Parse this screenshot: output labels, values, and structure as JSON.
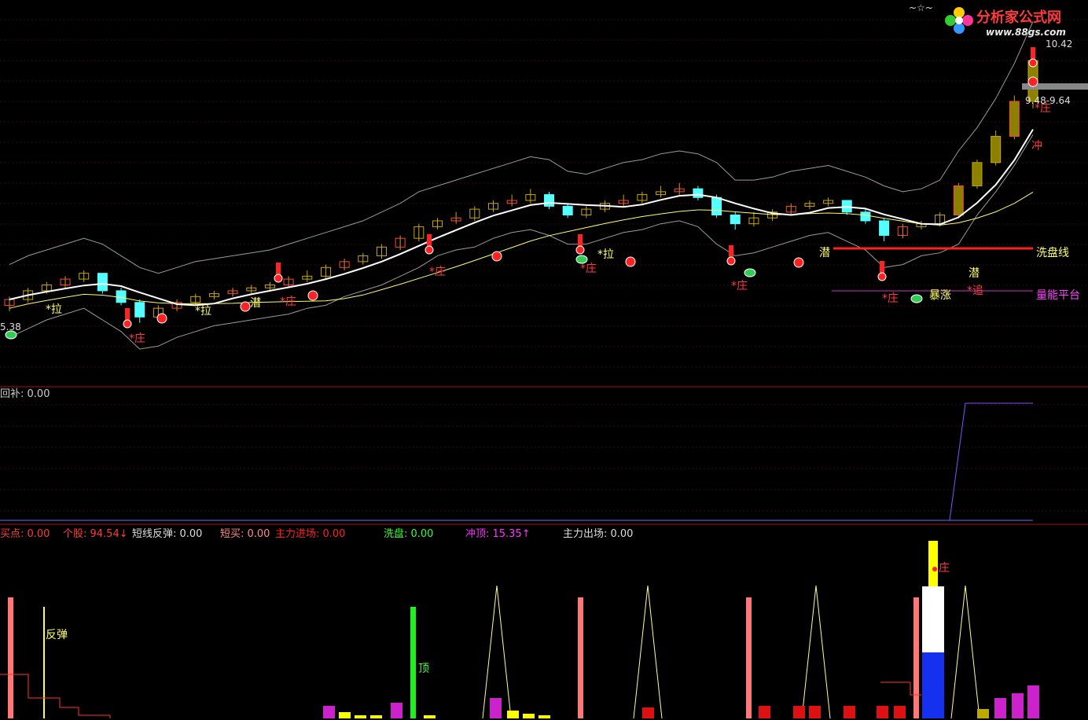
{
  "logo": {
    "title": "分析家公式网",
    "url": "www.88gs.com",
    "prefix": "~☆~"
  },
  "colors": {
    "background": "#000000",
    "up": "#ff3333",
    "down": "#54ffff",
    "ma": "#ffffff",
    "ma2": "#ffff66",
    "envelope": "#9a9a9a",
    "hollow": "#8b8000",
    "label_red": "#ff3b3b",
    "label_yellow": "#ffff66",
    "platform": "#cc33cc",
    "washline": "#ff2020"
  },
  "main_panel": {
    "price_low_label": "5.38",
    "price_high_label": "10.42",
    "range_label": "9.48-9.64",
    "line_labels": {
      "wash": "洗盘线",
      "platform": "量能平台"
    },
    "markers": [
      {
        "text": "*拉",
        "color": "label_yellow"
      },
      {
        "text": "*庄",
        "color": "label_red"
      },
      {
        "text": "*拉",
        "color": "label_yellow"
      },
      {
        "text": "潜",
        "color": "label_yellow"
      },
      {
        "text": "*庄",
        "color": "label_red"
      },
      {
        "text": "*庄",
        "color": "label_red"
      },
      {
        "text": "*拉",
        "color": "label_yellow"
      },
      {
        "text": "*庄",
        "color": "label_red"
      },
      {
        "text": "*庄",
        "color": "label_red"
      },
      {
        "text": "潜",
        "color": "label_yellow"
      },
      {
        "text": "*庄",
        "color": "label_red"
      },
      {
        "text": "暴涨",
        "color": "label_yellow"
      },
      {
        "text": "潜",
        "color": "label_yellow"
      },
      {
        "text": "*追",
        "color": "label_red"
      },
      {
        "text": "*庄",
        "color": "label_red"
      },
      {
        "text": "冲",
        "color": "label_red"
      },
      {
        "text": "顶",
        "color": "label_green"
      }
    ]
  },
  "sub_panel": {
    "label": "回补",
    "value": "0.00"
  },
  "indicator_bar": [
    {
      "name": "买点",
      "value": "0.00",
      "arrow": "",
      "color": "#ff3b3b"
    },
    {
      "name": "个股",
      "value": "94.54",
      "arrow": "↓",
      "color": "#ff3b3b"
    },
    {
      "name": "短线反弹",
      "value": "0.00",
      "arrow": "",
      "color": "#dddddd"
    },
    {
      "name": "短买",
      "value": "0.00",
      "arrow": "",
      "color": "#ff8888"
    },
    {
      "name": "主力进场",
      "value": "0.00",
      "arrow": "",
      "color": "#ff2020"
    },
    {
      "name": "洗盘",
      "value": "0.00",
      "arrow": "",
      "color": "#33ff33"
    },
    {
      "name": "冲顶",
      "value": "15.35",
      "arrow": "↑",
      "color": "#ff33ff"
    },
    {
      "name": "主力出场",
      "value": "0.00",
      "arrow": "",
      "color": "#dddddd"
    }
  ],
  "bottom_labels": {
    "rebound": "反弹",
    "top": "顶",
    "zhuang": "庄"
  },
  "chart_data": {
    "type": "candlestick",
    "candles": [
      [
        6.1,
        6.25,
        6.0,
        6.2
      ],
      [
        6.2,
        6.4,
        6.15,
        6.35
      ],
      [
        6.35,
        6.5,
        6.3,
        6.45
      ],
      [
        6.45,
        6.6,
        6.4,
        6.55
      ],
      [
        6.55,
        6.7,
        6.5,
        6.65
      ],
      [
        6.65,
        6.6,
        6.3,
        6.35
      ],
      [
        6.35,
        6.4,
        6.1,
        6.15
      ],
      [
        6.15,
        6.2,
        5.8,
        5.9
      ],
      [
        5.9,
        6.1,
        5.85,
        6.05
      ],
      [
        6.05,
        6.2,
        6.0,
        6.15
      ],
      [
        6.15,
        6.3,
        6.1,
        6.25
      ],
      [
        6.25,
        6.35,
        6.2,
        6.3
      ],
      [
        6.3,
        6.4,
        6.25,
        6.35
      ],
      [
        6.35,
        6.45,
        6.3,
        6.4
      ],
      [
        6.4,
        6.5,
        6.35,
        6.45
      ],
      [
        6.45,
        6.6,
        6.4,
        6.55
      ],
      [
        6.55,
        6.7,
        6.5,
        6.6
      ],
      [
        6.6,
        6.8,
        6.55,
        6.75
      ],
      [
        6.75,
        6.9,
        6.7,
        6.85
      ],
      [
        6.85,
        7.0,
        6.8,
        6.95
      ],
      [
        6.95,
        7.15,
        6.9,
        7.1
      ],
      [
        7.1,
        7.3,
        7.05,
        7.25
      ],
      [
        7.25,
        7.5,
        7.2,
        7.45
      ],
      [
        7.45,
        7.6,
        7.4,
        7.55
      ],
      [
        7.55,
        7.7,
        7.5,
        7.6
      ],
      [
        7.6,
        7.8,
        7.55,
        7.75
      ],
      [
        7.75,
        7.9,
        7.7,
        7.85
      ],
      [
        7.85,
        8.0,
        7.8,
        7.9
      ],
      [
        7.9,
        8.1,
        7.85,
        8.0
      ],
      [
        8.0,
        8.05,
        7.75,
        7.8
      ],
      [
        7.8,
        7.85,
        7.6,
        7.65
      ],
      [
        7.65,
        7.8,
        7.6,
        7.75
      ],
      [
        7.75,
        7.9,
        7.7,
        7.85
      ],
      [
        7.85,
        8.0,
        7.8,
        7.9
      ],
      [
        7.9,
        8.05,
        7.85,
        8.0
      ],
      [
        8.0,
        8.15,
        7.95,
        8.05
      ],
      [
        8.05,
        8.2,
        8.0,
        8.1
      ],
      [
        8.1,
        8.15,
        7.9,
        7.95
      ],
      [
        7.95,
        8.0,
        7.6,
        7.65
      ],
      [
        7.65,
        7.7,
        7.4,
        7.5
      ],
      [
        7.5,
        7.7,
        7.45,
        7.6
      ],
      [
        7.6,
        7.75,
        7.55,
        7.7
      ],
      [
        7.7,
        7.85,
        7.65,
        7.8
      ],
      [
        7.8,
        7.9,
        7.75,
        7.85
      ],
      [
        7.85,
        7.95,
        7.8,
        7.9
      ],
      [
        7.9,
        7.85,
        7.65,
        7.7
      ],
      [
        7.7,
        7.75,
        7.5,
        7.55
      ],
      [
        7.55,
        7.6,
        7.2,
        7.3
      ],
      [
        7.3,
        7.5,
        7.25,
        7.45
      ],
      [
        7.45,
        7.55,
        7.4,
        7.5
      ],
      [
        7.5,
        7.7,
        7.45,
        7.65
      ],
      [
        7.65,
        8.2,
        7.6,
        8.15
      ],
      [
        8.15,
        8.6,
        8.1,
        8.55
      ],
      [
        8.55,
        9.1,
        8.5,
        9.0
      ],
      [
        9.0,
        9.7,
        8.95,
        9.6
      ],
      [
        9.6,
        10.42,
        9.48,
        10.3
      ]
    ],
    "ylim": [
      5.0,
      10.8
    ]
  }
}
